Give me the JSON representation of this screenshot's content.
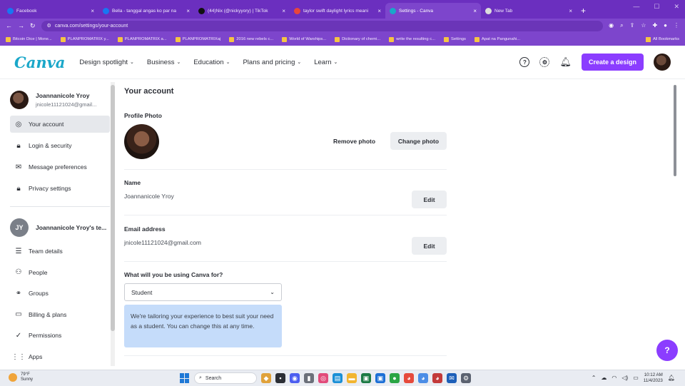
{
  "browser": {
    "tabs": [
      {
        "label": "Facebook",
        "color": "#1877f2",
        "active": false
      },
      {
        "label": "Bella - tanggal angas ko par na",
        "color": "#1877f2",
        "active": false
      },
      {
        "label": "(44)Nix (@nickyyory) | TikTok",
        "color": "#111111",
        "active": false
      },
      {
        "label": "taylor swift daylight lyrics meani",
        "color": "#e8453c",
        "active": false
      },
      {
        "label": "Settings - Canva",
        "color": "#1aa7c9",
        "active": true
      },
      {
        "label": "New Tab",
        "color": "#dcdcdc",
        "active": false
      }
    ],
    "new_tab": "+",
    "url": "canva.com/settings/your-account",
    "bookmarks": [
      "Bitcoin Dice | Mone...",
      "PLANPROMATRIX y...",
      "PLANPROMATRIX a...",
      "PLANPROMATRIXaj",
      "2016 new rebels c...",
      "World of Warships...",
      "Dictionary of chemi...",
      "write the resulting c...",
      "Settings",
      "Apat na Pangunahi..."
    ],
    "all_bookmarks": "All Bookmarks"
  },
  "header": {
    "logo": "Canva",
    "nav": [
      "Design spotlight",
      "Business",
      "Education",
      "Plans and pricing",
      "Learn"
    ],
    "create_button": "Create a design",
    "help_icon": "?"
  },
  "sidebar": {
    "user_name": "Joannanicole Yroy",
    "user_email": "jnicole11121024@gmail...",
    "items": [
      {
        "label": "Your account",
        "icon": "user-circle-icon",
        "glyph": "◎",
        "active": true
      },
      {
        "label": "Login & security",
        "icon": "lock-icon",
        "glyph": "🔒︎",
        "active": false
      },
      {
        "label": "Message preferences",
        "icon": "mail-icon",
        "glyph": "✉",
        "active": false
      },
      {
        "label": "Privacy settings",
        "icon": "lock-icon",
        "glyph": "🔒︎",
        "active": false
      }
    ],
    "team_initials": "JY",
    "team_name": "Joannanicole Yroy's te...",
    "team_items": [
      {
        "label": "Team details",
        "icon": "list-icon",
        "glyph": "☰"
      },
      {
        "label": "People",
        "icon": "people-icon",
        "glyph": "⚇"
      },
      {
        "label": "Groups",
        "icon": "groups-icon",
        "glyph": "⚭"
      },
      {
        "label": "Billing & plans",
        "icon": "card-icon",
        "glyph": "▭"
      },
      {
        "label": "Permissions",
        "icon": "check-circle-icon",
        "glyph": "✓"
      },
      {
        "label": "Apps",
        "icon": "grid-icon",
        "glyph": "⋮⋮"
      }
    ]
  },
  "main": {
    "title": "Your account",
    "profile_photo_label": "Profile Photo",
    "remove_photo": "Remove photo",
    "change_photo": "Change photo",
    "name_label": "Name",
    "name_value": "Joannanicole Yroy",
    "email_label": "Email address",
    "email_value": "jnicole11121024@gmail.com",
    "edit": "Edit",
    "usage_label": "What will you be using Canva for?",
    "usage_value": "Student",
    "info_text": "We're tailoring your experience to best suit your need as a student. You can change this at any time.",
    "help_fab": "?"
  },
  "taskbar": {
    "temp": "79°F",
    "weather": "Sunny",
    "search_placeholder": "Search",
    "time": "10:12 AM",
    "date": "11/4/2023"
  }
}
